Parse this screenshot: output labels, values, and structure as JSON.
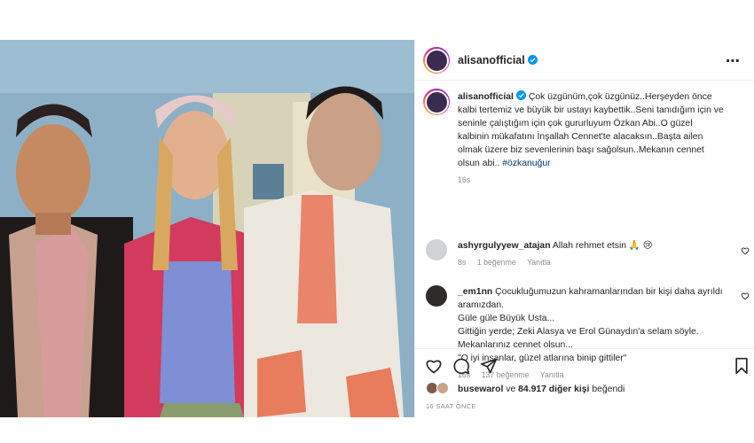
{
  "post": {
    "username": "alisanofficial",
    "caption_username": "alisanofficial",
    "caption_text": "Çok üzgünüm,çok üzgünüz..Herşeyden önce kalbi tertemiz ve büyük bir ustayı kaybettik..Seni tanıdığım için ve seninle çalıştığım için çok gururluyum Özkan Abi..O güzel kalbinin mükafatını İnşallah Cennet'te alacaksın..Başta ailen olmak üzere biz sevenlerinin başı sağolsun..Mekanın cennet olsun abi..",
    "caption_hashtag": "#özkanuğur",
    "caption_time": "16s",
    "more_icon": "⋯"
  },
  "comments": [
    {
      "username": "ashyrgulyyew_atajan",
      "text": "Allah rehmet etsin 🙏 😢",
      "time": "8s",
      "likes": "1 beğenme",
      "reply": "Yanıtla"
    },
    {
      "username": "_em1nn",
      "text_lines": [
        "Çocukluğumuzun kahramanlarından bir kişi daha ayrıldı aramızdan.",
        "Güle güle Büyük Usta...",
        "Gittiğin yerde; Zeki Alasya ve Erol Günaydın'a selam söyle.",
        "Mekanlarınız cennet olsun...",
        "\"O iyi insanlar, güzel atlarına binip gittiler\""
      ],
      "time": "16s",
      "likes": "137 beğenme",
      "reply": "Yanıtla"
    }
  ],
  "footer": {
    "liked_user": "busewarol",
    "liked_rest_prefix": " ve ",
    "liked_count": "84.917 diğer kişi",
    "liked_suffix": " beğendi",
    "time_ago": "16 SAAT ÖNCE"
  },
  "colors": {
    "text": "#262626",
    "muted": "#8e8e8e",
    "hashtag": "#00376b",
    "verified": "#0095f6",
    "border": "#efefef"
  }
}
